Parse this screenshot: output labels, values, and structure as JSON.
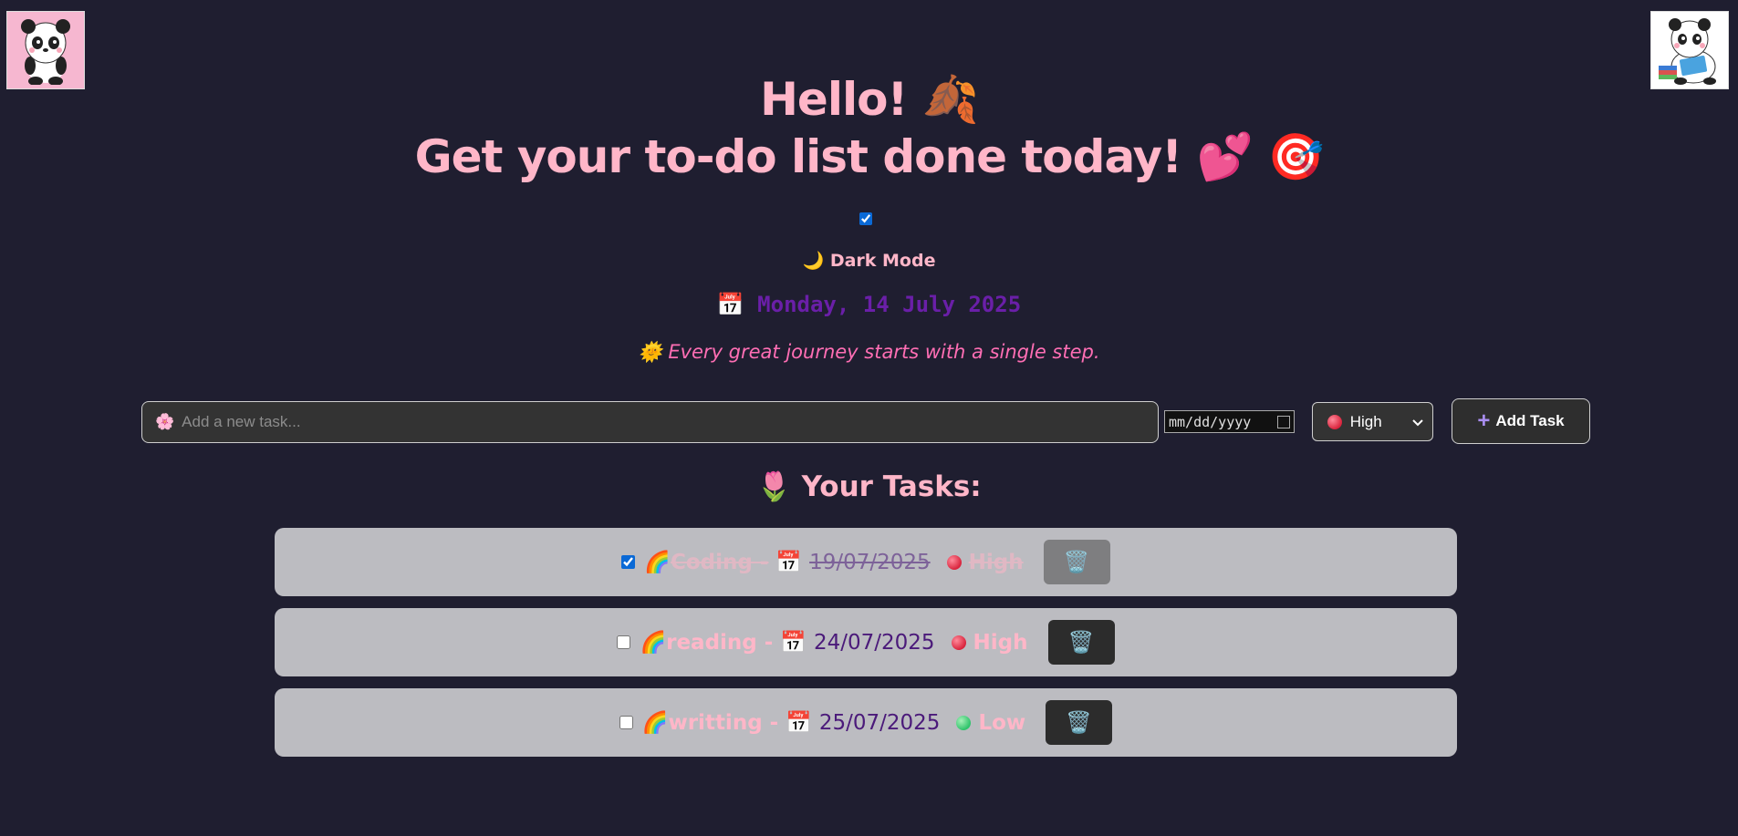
{
  "header": {
    "greeting": "Hello!",
    "headline": "Get your to-do list done today!"
  },
  "theme": {
    "dark_mode_label": "Dark Mode",
    "dark_mode_checked": true
  },
  "today": {
    "date_text": "Monday, 14 July 2025"
  },
  "quote": {
    "text": "Every great journey starts with a single step."
  },
  "new_task": {
    "placeholder": "Add a new task...",
    "date_placeholder": "mm/dd/yyyy",
    "priority_selected": "High",
    "add_label": "Add Task"
  },
  "tasks_heading": "Your Tasks:",
  "tasks": [
    {
      "name": "Coding -",
      "date": "19/07/2025",
      "priority": "High",
      "done": true
    },
    {
      "name": "reading -",
      "date": "24/07/2025",
      "priority": "High",
      "done": false
    },
    {
      "name": "writting -",
      "date": "25/07/2025",
      "priority": "Low",
      "done": false
    }
  ],
  "colors": {
    "background": "#1f1e30",
    "title_pink": "#ffb6c8",
    "date_purple": "#6a1fa8",
    "quote_pink": "#ff6eb4",
    "task_card": "#bcbcc1"
  },
  "icons": [
    "panda-waving-icon",
    "panda-reading-icon",
    "leaf-icon",
    "heart-icon",
    "target-icon",
    "moon-icon",
    "calendar-icon",
    "sun-icon",
    "flower-icon",
    "tulip-icon",
    "rainbow-icon",
    "trash-icon",
    "plus-icon"
  ]
}
